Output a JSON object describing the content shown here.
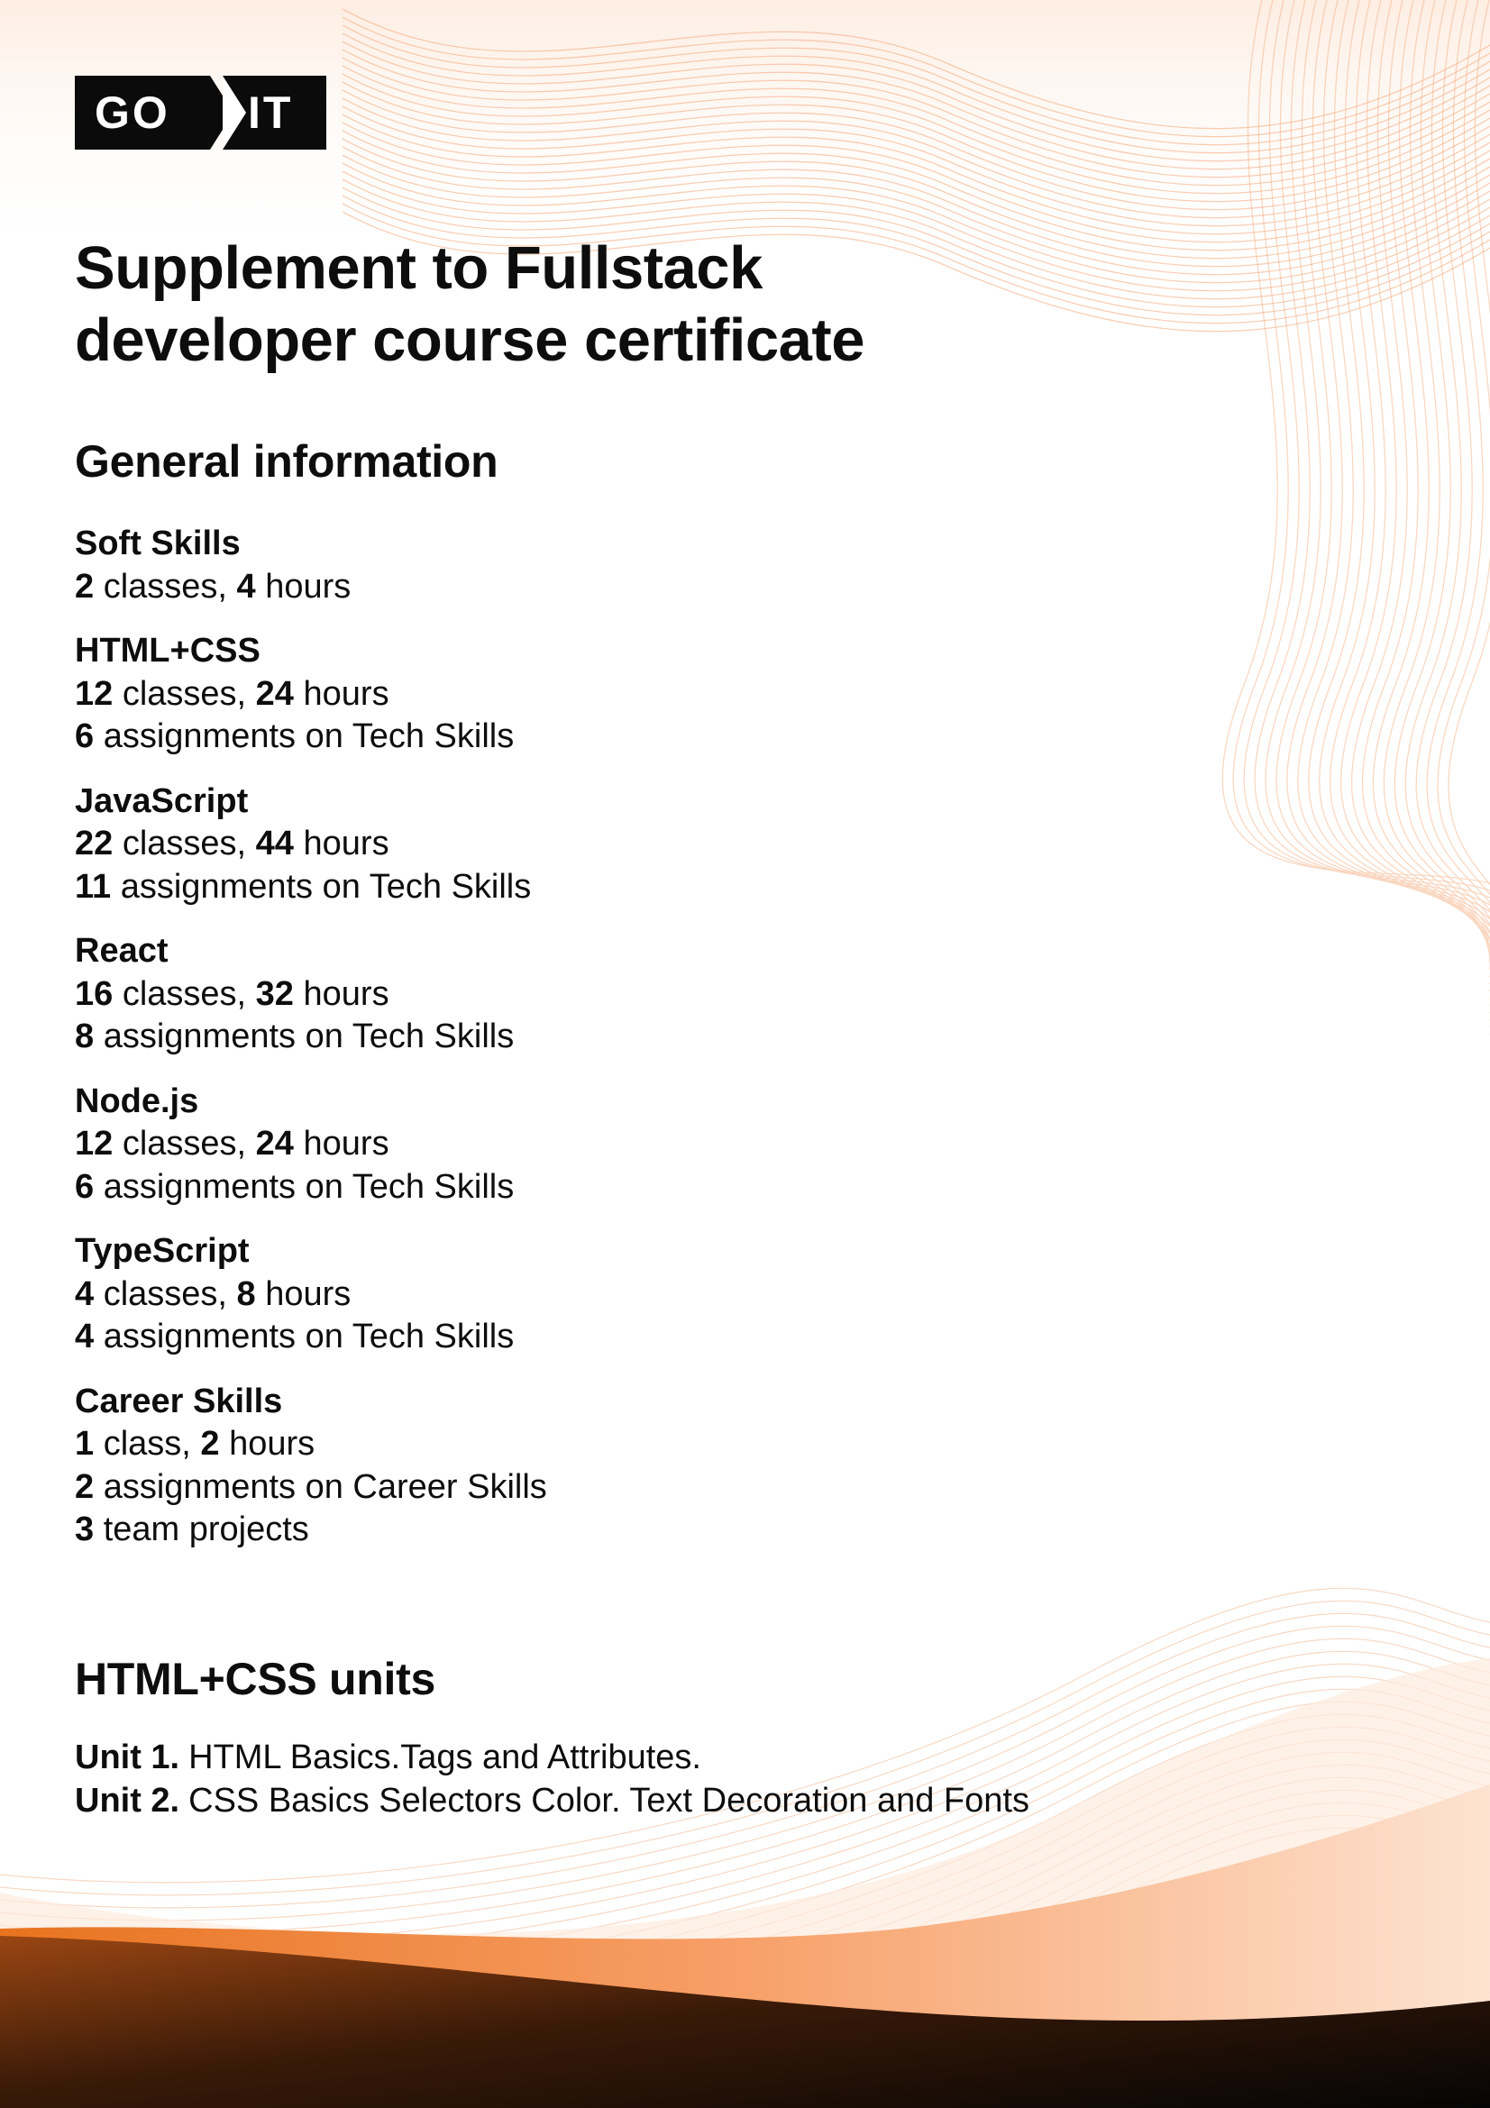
{
  "logo": {
    "left": "GO",
    "right": "IT"
  },
  "title": {
    "line1": "Supplement to Fullstack",
    "line2": "developer course certificate"
  },
  "general": {
    "heading": "General information",
    "sections": [
      {
        "title": "Soft Skills",
        "lines": [
          {
            "num": "2",
            "text": " classes, ",
            "num2": "4",
            "text2": " hours"
          }
        ]
      },
      {
        "title": "HTML+CSS",
        "lines": [
          {
            "num": "12",
            "text": " classes, ",
            "num2": "24",
            "text2": " hours"
          },
          {
            "num": "6",
            "text": " assignments on Tech Skills"
          }
        ]
      },
      {
        "title": "JavaScript",
        "lines": [
          {
            "num": "22",
            "text": " classes, ",
            "num2": "44",
            "text2": " hours"
          },
          {
            "num": "11",
            "text": " assignments on Tech Skills"
          }
        ]
      },
      {
        "title": "React",
        "lines": [
          {
            "num": "16",
            "text": " classes, ",
            "num2": "32",
            "text2": " hours"
          },
          {
            "num": "8",
            "text": " assignments on Tech Skills"
          }
        ]
      },
      {
        "title": "Node.js",
        "lines": [
          {
            "num": "12",
            "text": " classes, ",
            "num2": "24",
            "text2": " hours"
          },
          {
            "num": "6",
            "text": " assignments on Tech Skills"
          }
        ]
      },
      {
        "title": "TypeScript",
        "lines": [
          {
            "num": "4",
            "text": " classes, ",
            "num2": "8",
            "text2": " hours"
          },
          {
            "num": "4",
            "text": " assignments on Tech Skills"
          }
        ]
      },
      {
        "title": "Career Skills",
        "lines": [
          {
            "num": "1",
            "text": " class, ",
            "num2": "2",
            "text2": " hours"
          },
          {
            "num": "2",
            "text": " assignments on Career Skills"
          },
          {
            "num": "3",
            "text": " team projects"
          }
        ]
      }
    ]
  },
  "units": {
    "heading": "HTML+CSS units",
    "items": [
      {
        "label": "Unit 1.",
        "text": "HTML Basics.Tags and Attributes."
      },
      {
        "label": "Unit 2.",
        "text": "CSS Basics Selectors Color. Text Decoration and Fonts"
      }
    ]
  },
  "colors": {
    "accent": "#f07a2a",
    "dark": "#0b0b0b",
    "text": "#0d0d0d"
  }
}
